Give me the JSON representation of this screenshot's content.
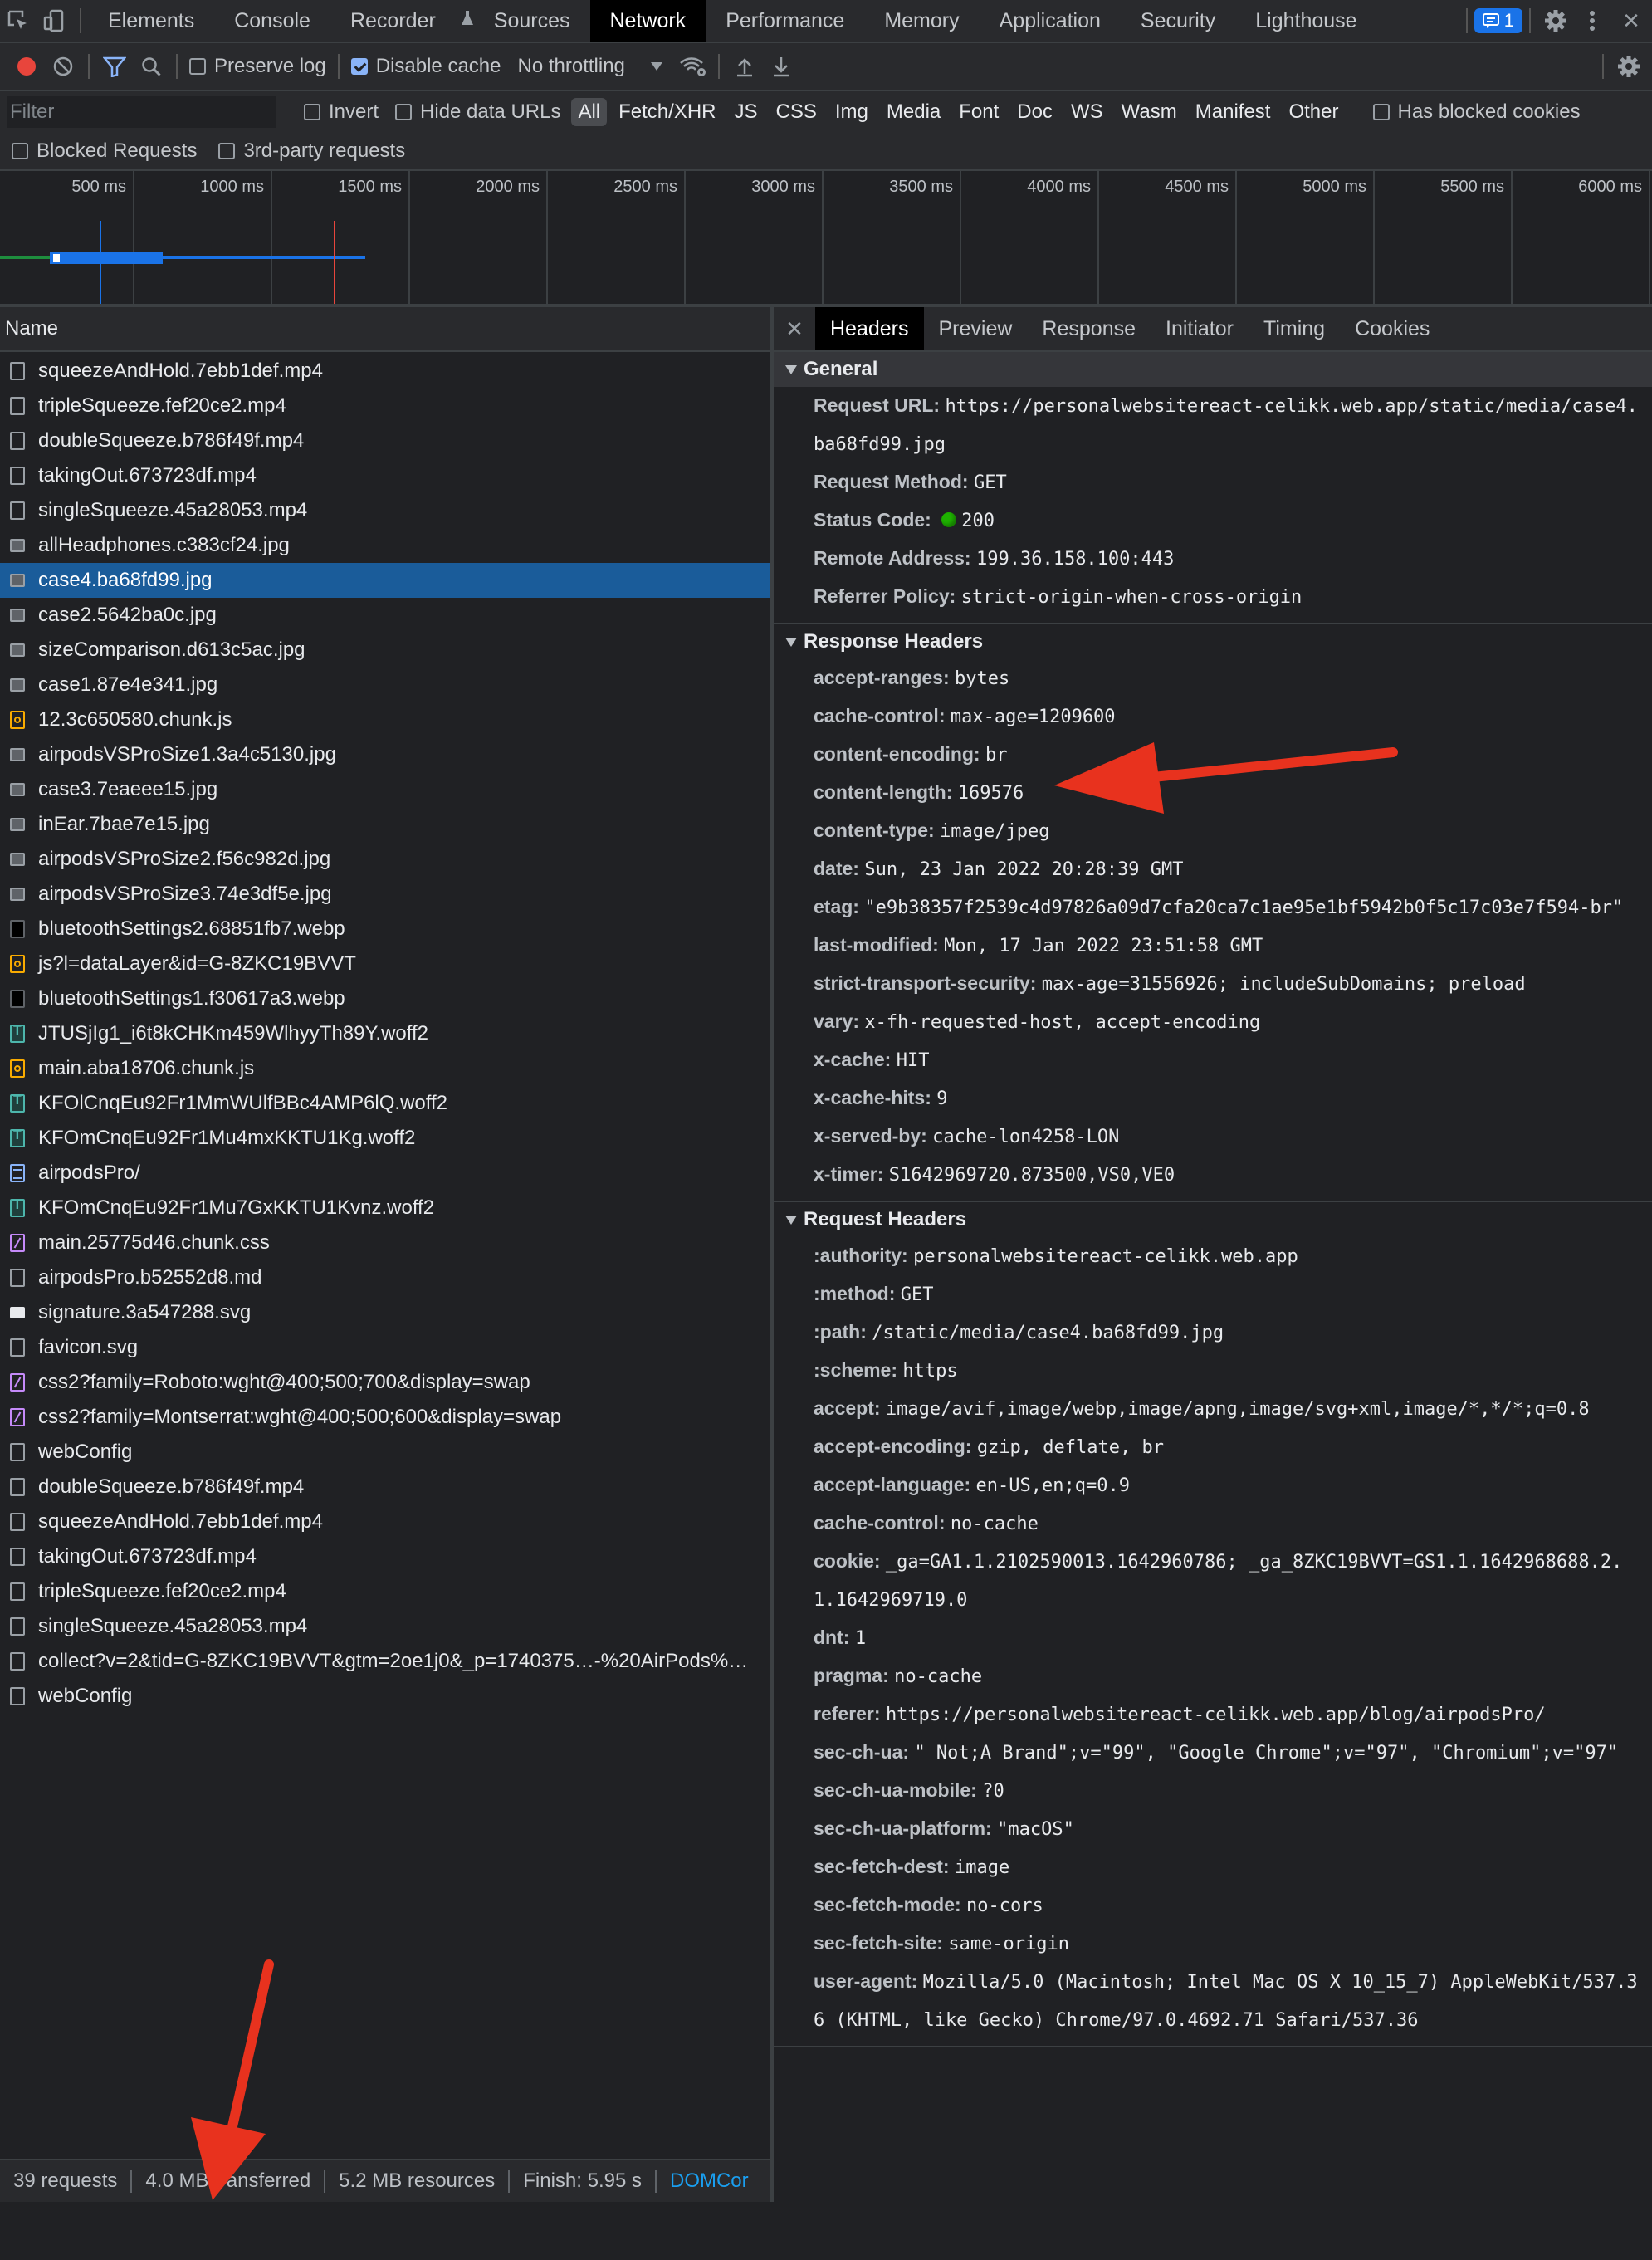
{
  "main_tabs": [
    "Elements",
    "Console",
    "Recorder",
    "Sources",
    "Network",
    "Performance",
    "Memory",
    "Application",
    "Security",
    "Lighthouse"
  ],
  "issues_count": "1",
  "toolbar": {
    "preserve_log": "Preserve log",
    "disable_cache": "Disable cache",
    "throttling": "No throttling"
  },
  "filter": {
    "placeholder": "Filter",
    "invert": "Invert",
    "hide_data_urls": "Hide data URLs",
    "types": [
      "All",
      "Fetch/XHR",
      "JS",
      "CSS",
      "Img",
      "Media",
      "Font",
      "Doc",
      "WS",
      "Wasm",
      "Manifest",
      "Other"
    ],
    "has_blocked_cookies": "Has blocked cookies",
    "blocked_requests": "Blocked Requests",
    "third_party": "3rd-party requests"
  },
  "timeline_ticks": [
    "500 ms",
    "1000 ms",
    "1500 ms",
    "2000 ms",
    "2500 ms",
    "3000 ms",
    "3500 ms",
    "4000 ms",
    "4500 ms",
    "5000 ms",
    "5500 ms",
    "6000 ms"
  ],
  "requests_header": "Name",
  "requests": [
    {
      "name": "squeezeAndHold.7ebb1def.mp4",
      "type": "media"
    },
    {
      "name": "tripleSqueeze.fef20ce2.mp4",
      "type": "media"
    },
    {
      "name": "doubleSqueeze.b786f49f.mp4",
      "type": "media"
    },
    {
      "name": "takingOut.673723df.mp4",
      "type": "media"
    },
    {
      "name": "singleSqueeze.45a28053.mp4",
      "type": "media"
    },
    {
      "name": "allHeadphones.c383cf24.jpg",
      "type": "img"
    },
    {
      "name": "case4.ba68fd99.jpg",
      "type": "img"
    },
    {
      "name": "case2.5642ba0c.jpg",
      "type": "img"
    },
    {
      "name": "sizeComparison.d613c5ac.jpg",
      "type": "img"
    },
    {
      "name": "case1.87e4e341.jpg",
      "type": "img"
    },
    {
      "name": "12.3c650580.chunk.js",
      "type": "js"
    },
    {
      "name": "airpodsVSProSize1.3a4c5130.jpg",
      "type": "img"
    },
    {
      "name": "case3.7eaeee15.jpg",
      "type": "img"
    },
    {
      "name": "inEar.7bae7e15.jpg",
      "type": "img"
    },
    {
      "name": "airpodsVSProSize2.f56c982d.jpg",
      "type": "img"
    },
    {
      "name": "airpodsVSProSize3.74e3df5e.jpg",
      "type": "img"
    },
    {
      "name": "bluetoothSettings2.68851fb7.webp",
      "type": "dark"
    },
    {
      "name": "js?l=dataLayer&id=G-8ZKC19BVVT",
      "type": "js"
    },
    {
      "name": "bluetoothSettings1.f30617a3.webp",
      "type": "dark"
    },
    {
      "name": "JTUSjIg1_i6t8kCHKm459WlhyyTh89Y.woff2",
      "type": "font"
    },
    {
      "name": "main.aba18706.chunk.js",
      "type": "js"
    },
    {
      "name": "KFOlCnqEu92Fr1MmWUlfBBc4AMP6lQ.woff2",
      "type": "font"
    },
    {
      "name": "KFOmCnqEu92Fr1Mu4mxKKTU1Kg.woff2",
      "type": "font"
    },
    {
      "name": "airpodsPro/",
      "type": "doc"
    },
    {
      "name": "KFOmCnqEu92Fr1Mu7GxKKTU1Kvnz.woff2",
      "type": "font"
    },
    {
      "name": "main.25775d46.chunk.css",
      "type": "css"
    },
    {
      "name": "airpodsPro.b52552d8.md",
      "type": "media"
    },
    {
      "name": "signature.3a547288.svg",
      "type": "svg"
    },
    {
      "name": "favicon.svg",
      "type": "media"
    },
    {
      "name": "css2?family=Roboto:wght@400;500;700&display=swap",
      "type": "css"
    },
    {
      "name": "css2?family=Montserrat:wght@400;500;600&display=swap",
      "type": "css"
    },
    {
      "name": "webConfig",
      "type": "media"
    },
    {
      "name": "doubleSqueeze.b786f49f.mp4",
      "type": "media"
    },
    {
      "name": "squeezeAndHold.7ebb1def.mp4",
      "type": "media"
    },
    {
      "name": "takingOut.673723df.mp4",
      "type": "media"
    },
    {
      "name": "tripleSqueeze.fef20ce2.mp4",
      "type": "media"
    },
    {
      "name": "singleSqueeze.45a28053.mp4",
      "type": "media"
    },
    {
      "name": "collect?v=2&tid=G-8ZKC19BVVT&gtm=2oe1j0&_p=1740375…-%20AirPods%…",
      "type": "media"
    },
    {
      "name": "webConfig",
      "type": "media"
    }
  ],
  "status": {
    "requests": "39 requests",
    "transferred": "4.0 MB transferred",
    "resources": "5.2 MB resources",
    "finish": "Finish: 5.95 s",
    "domcontent": "DOMCor"
  },
  "detail_tabs": [
    "Headers",
    "Preview",
    "Response",
    "Initiator",
    "Timing",
    "Cookies"
  ],
  "general": {
    "title": "General",
    "rows": [
      {
        "k": "Request URL:",
        "v": "https://personalwebsitereact-celikk.web.app/static/media/case4.ba68fd99.jpg"
      },
      {
        "k": "Request Method:",
        "v": "GET"
      },
      {
        "k": "Status Code:",
        "v": "200"
      },
      {
        "k": "Remote Address:",
        "v": "199.36.158.100:443"
      },
      {
        "k": "Referrer Policy:",
        "v": "strict-origin-when-cross-origin"
      }
    ]
  },
  "response_headers": {
    "title": "Response Headers",
    "rows": [
      {
        "k": "accept-ranges:",
        "v": "bytes"
      },
      {
        "k": "cache-control:",
        "v": "max-age=1209600"
      },
      {
        "k": "content-encoding:",
        "v": "br"
      },
      {
        "k": "content-length:",
        "v": "169576"
      },
      {
        "k": "content-type:",
        "v": "image/jpeg"
      },
      {
        "k": "date:",
        "v": "Sun, 23 Jan 2022 20:28:39 GMT"
      },
      {
        "k": "etag:",
        "v": "\"e9b38357f2539c4d97826a09d7cfa20ca7c1ae95e1bf5942b0f5c17c03e7f594-br\""
      },
      {
        "k": "last-modified:",
        "v": "Mon, 17 Jan 2022 23:51:58 GMT"
      },
      {
        "k": "strict-transport-security:",
        "v": "max-age=31556926; includeSubDomains; preload"
      },
      {
        "k": "vary:",
        "v": "x-fh-requested-host, accept-encoding"
      },
      {
        "k": "x-cache:",
        "v": "HIT"
      },
      {
        "k": "x-cache-hits:",
        "v": "9"
      },
      {
        "k": "x-served-by:",
        "v": "cache-lon4258-LON"
      },
      {
        "k": "x-timer:",
        "v": "S1642969720.873500,VS0,VE0"
      }
    ]
  },
  "request_headers": {
    "title": "Request Headers",
    "rows": [
      {
        "k": ":authority:",
        "v": "personalwebsitereact-celikk.web.app"
      },
      {
        "k": ":method:",
        "v": "GET"
      },
      {
        "k": ":path:",
        "v": "/static/media/case4.ba68fd99.jpg"
      },
      {
        "k": ":scheme:",
        "v": "https"
      },
      {
        "k": "accept:",
        "v": "image/avif,image/webp,image/apng,image/svg+xml,image/*,*/*;q=0.8"
      },
      {
        "k": "accept-encoding:",
        "v": "gzip, deflate, br"
      },
      {
        "k": "accept-language:",
        "v": "en-US,en;q=0.9"
      },
      {
        "k": "cache-control:",
        "v": "no-cache"
      },
      {
        "k": "cookie:",
        "v": "_ga=GA1.1.2102590013.1642960786; _ga_8ZKC19BVVT=GS1.1.1642968688.2.1.1642969719.0"
      },
      {
        "k": "dnt:",
        "v": "1"
      },
      {
        "k": "pragma:",
        "v": "no-cache"
      },
      {
        "k": "referer:",
        "v": "https://personalwebsitereact-celikk.web.app/blog/airpodsPro/"
      },
      {
        "k": "sec-ch-ua:",
        "v": "\" Not;A Brand\";v=\"99\", \"Google Chrome\";v=\"97\", \"Chromium\";v=\"97\""
      },
      {
        "k": "sec-ch-ua-mobile:",
        "v": "?0"
      },
      {
        "k": "sec-ch-ua-platform:",
        "v": "\"macOS\""
      },
      {
        "k": "sec-fetch-dest:",
        "v": "image"
      },
      {
        "k": "sec-fetch-mode:",
        "v": "no-cors"
      },
      {
        "k": "sec-fetch-site:",
        "v": "same-origin"
      },
      {
        "k": "user-agent:",
        "v": "Mozilla/5.0 (Macintosh; Intel Mac OS X 10_15_7) AppleWebKit/537.36 (KHTML, like Gecko) Chrome/97.0.4692.71 Safari/537.36"
      }
    ]
  },
  "colors": {
    "accent": "#1a73e8",
    "selected_row": "#1a5c9a",
    "status_ok": "#1eb100",
    "annotation_arrow": "#e8321e"
  }
}
